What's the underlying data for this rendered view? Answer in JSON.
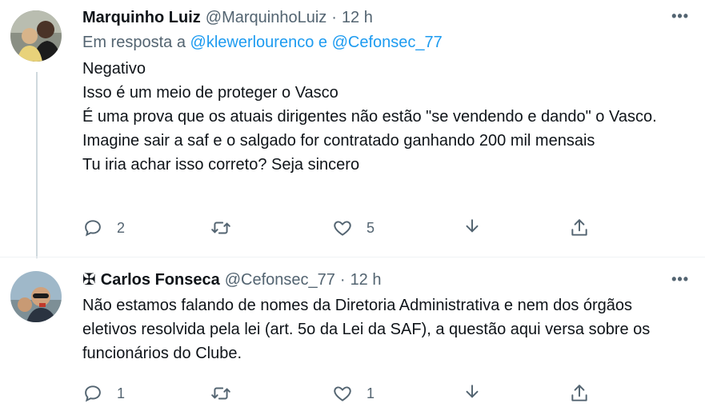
{
  "tweets": [
    {
      "name": "Marquinho Luiz",
      "handle": "@MarquinhoLuiz",
      "separator": "·",
      "time": "12 h",
      "reply_prefix": "Em resposta a",
      "reply_mention_1": "@klewerlourenco",
      "reply_conjunction": "e",
      "reply_mention_2": "@Cefonsec_77",
      "lines": [
        "Negativo",
        "Isso é um meio de proteger o Vasco",
        "É uma prova que os atuais dirigentes não estão \"se vendendo e dando\" o Vasco.",
        "Imagine sair a saf e o salgado for contratado ganhando 200 mil mensais",
        "Tu iria achar isso correto? Seja sincero"
      ],
      "more_label": "•••",
      "replies": "2",
      "retweets": "",
      "likes": "5"
    },
    {
      "badge": "✠",
      "name": "Carlos Fonseca",
      "handle": "@Cefonsec_77",
      "separator": "·",
      "time": "12 h",
      "text": "Não estamos falando de nomes da Diretoria Administrativa e nem dos órgãos eletivos resolvida pela lei (art. 5o da Lei da SAF), a questão aqui versa sobre os funcionários do Clube.",
      "more_label": "•••",
      "replies": "1",
      "retweets": "",
      "likes": "1"
    }
  ],
  "icons": [
    "reply-icon",
    "retweet-icon",
    "like-icon",
    "download-icon",
    "share-icon",
    "more-icon"
  ],
  "colors": {
    "text": "#0f1419",
    "secondary": "#536471",
    "link": "#1d9bf0",
    "thread_line": "#cfd9de"
  }
}
